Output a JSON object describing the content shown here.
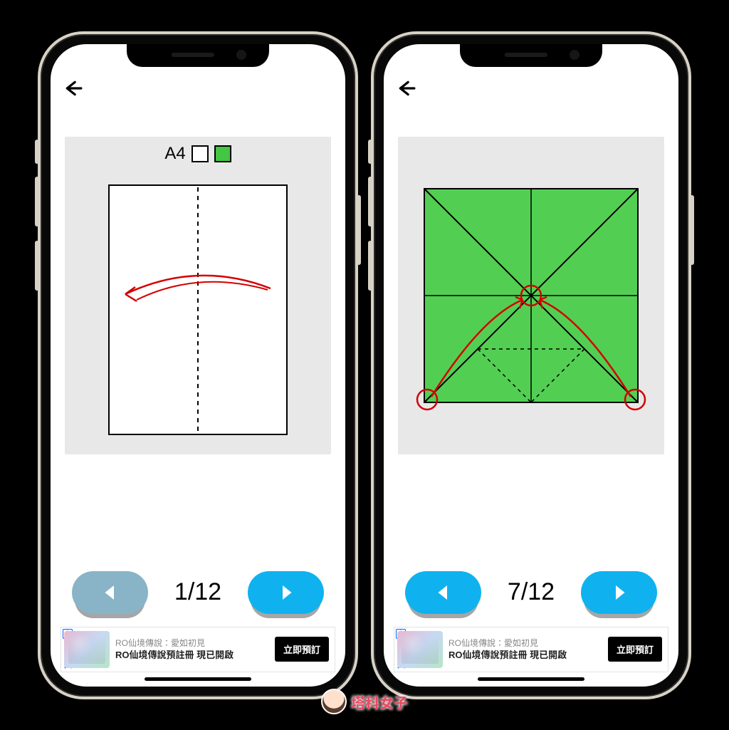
{
  "left": {
    "step_current": 1,
    "step_total": 12,
    "counter_text": "1/12",
    "paper_size_label": "A4",
    "swatches": [
      "white",
      "green"
    ],
    "prev_enabled": false,
    "next_enabled": true
  },
  "right": {
    "step_current": 7,
    "step_total": 12,
    "counter_text": "7/12",
    "prev_enabled": true,
    "next_enabled": true
  },
  "ad": {
    "subtitle": "RO仙境傳說：愛如初見",
    "title_line": "RO仙境傳說預註冊 現已開啟",
    "cta": "立即預訂"
  },
  "watermark": "塔科女子",
  "colors": {
    "accent_blue": "#0fb2ef",
    "accent_green": "#52cf52",
    "fold_red": "#d40000"
  }
}
